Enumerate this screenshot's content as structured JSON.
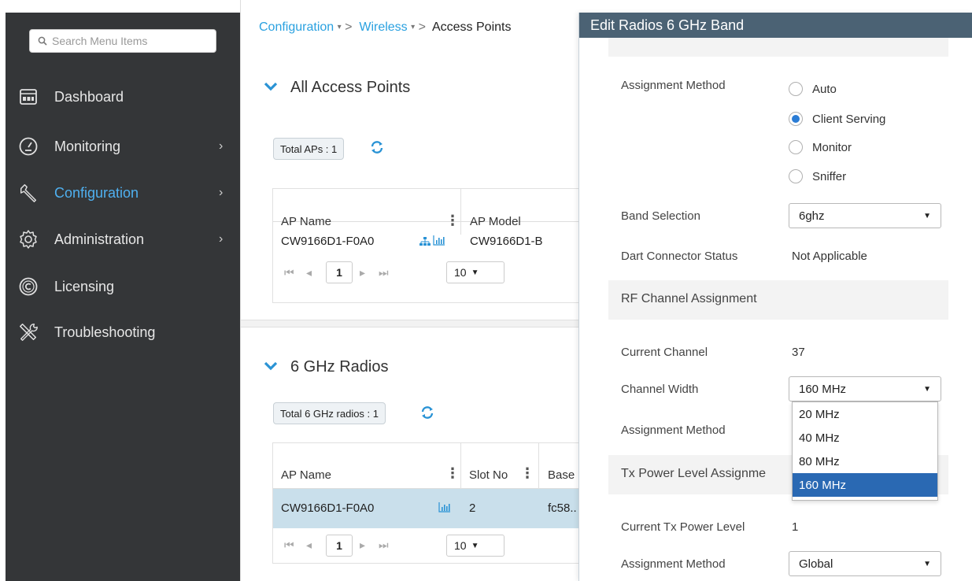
{
  "sidebar": {
    "search_placeholder": "Search Menu Items",
    "items": [
      {
        "label": "Dashboard",
        "icon": "dashboard-icon",
        "chevron": false
      },
      {
        "label": "Monitoring",
        "icon": "gauge-icon",
        "chevron": true
      },
      {
        "label": "Configuration",
        "icon": "wrench-icon",
        "chevron": true,
        "active": true
      },
      {
        "label": "Administration",
        "icon": "gear-icon",
        "chevron": true
      },
      {
        "label": "Licensing",
        "icon": "copyright-icon",
        "chevron": false
      },
      {
        "label": "Troubleshooting",
        "icon": "tools-icon",
        "chevron": false
      }
    ],
    "chevron_glyph": "›"
  },
  "breadcrumb": {
    "item1": "Configuration",
    "item2": "Wireless",
    "item3": "Access Points",
    "caret": "▾",
    "separator": ">"
  },
  "all_aps": {
    "title": "All Access Points",
    "total_chip": "Total APs : 1",
    "columns": [
      "AP Name",
      "AP Model"
    ],
    "rows": [
      {
        "ap_name": "CW9166D1-F0A0",
        "ap_model": "CW9166D1-B"
      }
    ],
    "pager": {
      "page": "1",
      "per_page": "10"
    }
  },
  "radios": {
    "title": "6 GHz Radios",
    "total_chip": "Total 6 GHz radios : 1",
    "columns": [
      "AP Name",
      "Slot No",
      "Base"
    ],
    "rows": [
      {
        "ap_name": "CW9166D1-F0A0",
        "slot": "2",
        "base": "fc58.."
      }
    ],
    "pager": {
      "page": "1",
      "per_page": "10"
    }
  },
  "panel": {
    "title": "Edit Radios 6 GHz Band",
    "assignment_method_label": "Assignment Method",
    "assignment_options": [
      "Auto",
      "Client Serving",
      "Monitor",
      "Sniffer"
    ],
    "assignment_selected": "Client Serving",
    "band_selection_label": "Band Selection",
    "band_selection_value": "6ghz",
    "dart_label": "Dart Connector Status",
    "dart_value": "Not Applicable",
    "rf_section": "RF Channel Assignment",
    "current_channel_label": "Current Channel",
    "current_channel_value": "37",
    "channel_width_label": "Channel Width",
    "channel_width_value": "160 MHz",
    "channel_width_options": [
      "20 MHz",
      "40 MHz",
      "80 MHz",
      "160 MHz"
    ],
    "channel_assignment_method_label": "Assignment Method",
    "tx_section": "Tx Power Level Assignme",
    "current_tx_label": "Current Tx Power Level",
    "current_tx_value": "1",
    "tx_assignment_method_label": "Assignment Method",
    "tx_assignment_value": "Global"
  },
  "colors": {
    "sidebar_bg": "#343638",
    "link_blue": "#2aa1e0",
    "panel_header": "#4b6274",
    "selected_row": "#c9dfeb",
    "dropdown_selected": "#2a69b3"
  }
}
